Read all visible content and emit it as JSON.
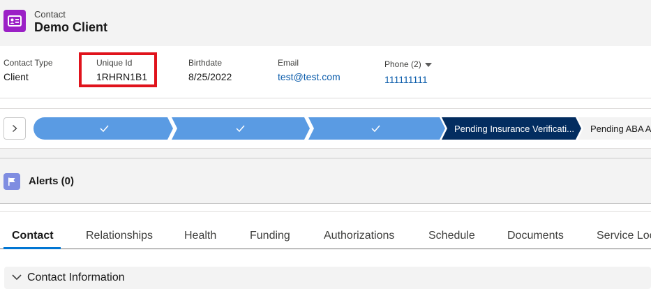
{
  "header": {
    "object_label": "Contact",
    "record_name": "Demo Client",
    "object_icon": "contact-card-icon"
  },
  "highlights": {
    "contact_type": {
      "label": "Contact Type",
      "value": "Client"
    },
    "unique_id": {
      "label": "Unique Id",
      "value": "1RHRN1B1"
    },
    "birthdate": {
      "label": "Birthdate",
      "value": "8/25/2022"
    },
    "email": {
      "label": "Email",
      "value": "test@test.com"
    },
    "phone": {
      "label": "Phone (2)",
      "value": "111111111"
    }
  },
  "path": {
    "stages": [
      {
        "status": "complete",
        "label": ""
      },
      {
        "status": "complete",
        "label": ""
      },
      {
        "status": "complete",
        "label": ""
      },
      {
        "status": "current",
        "label": "Pending Insurance Verificati..."
      },
      {
        "status": "incomplete",
        "label": "Pending ABA A"
      }
    ],
    "colors": {
      "complete": "#5a9be3",
      "current": "#032d60",
      "incomplete": "#f3f3f3"
    }
  },
  "alerts": {
    "title": "Alerts (0)",
    "icon": "flag-icon"
  },
  "tabs": [
    {
      "label": "Contact",
      "active": true
    },
    {
      "label": "Relationships"
    },
    {
      "label": "Health"
    },
    {
      "label": "Funding"
    },
    {
      "label": "Authorizations"
    },
    {
      "label": "Schedule"
    },
    {
      "label": "Documents"
    },
    {
      "label": "Service Loc"
    }
  ],
  "section": {
    "title": "Contact Information",
    "icon": "chevron-down-icon"
  },
  "colors": {
    "accent": "#0176d3",
    "highlight_box": "#e0131c",
    "object_icon_bg": "#9b20c6"
  }
}
